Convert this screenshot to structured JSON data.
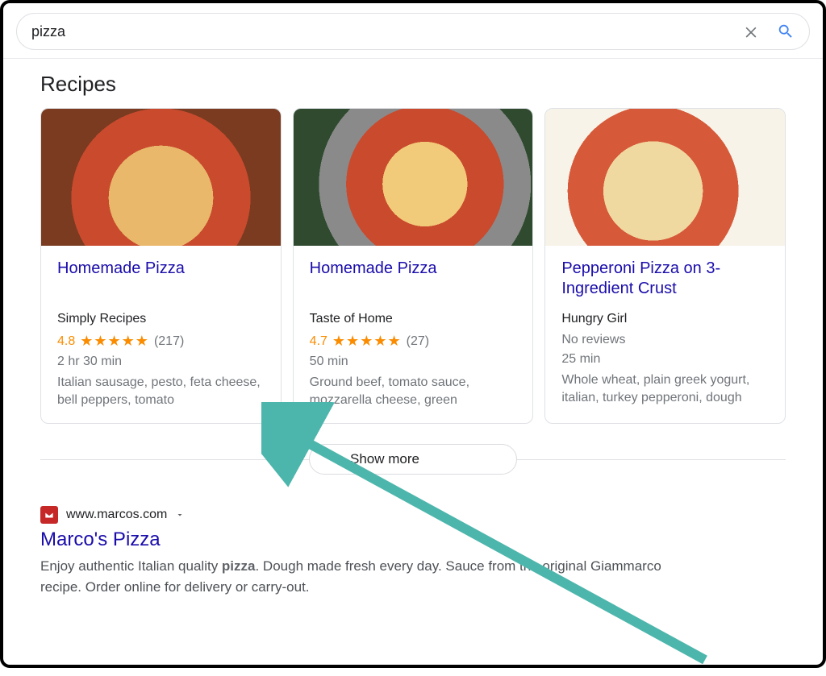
{
  "search": {
    "query": "pizza",
    "clear_icon": "clear-icon",
    "search_icon": "search-icon"
  },
  "section_title": "Recipes",
  "recipes": [
    {
      "title": "Homemade Pizza",
      "source": "Simply Recipes",
      "rating": "4.8",
      "stars": "★★★★★",
      "reviews": "(217)",
      "time": "2 hr 30 min",
      "ingredients": "Italian sausage, pesto, feta cheese, bell peppers, tomato"
    },
    {
      "title": "Homemade Pizza",
      "source": "Taste of Home",
      "rating": "4.7",
      "stars": "★★★★★",
      "reviews": "(27)",
      "time": "50 min",
      "ingredients": "Ground beef, tomato sauce, mozzarella cheese, green"
    },
    {
      "title": "Pepperoni Pizza on 3-Ingredient Crust",
      "source": "Hungry Girl",
      "no_reviews": "No reviews",
      "time": "25 min",
      "ingredients": "Whole wheat, plain greek yogurt, italian, turkey pepperoni, dough"
    }
  ],
  "show_more": "Show more",
  "result": {
    "url": "www.marcos.com",
    "title": "Marco's Pizza",
    "desc_pre": "Enjoy authentic Italian quality ",
    "desc_bold": "pizza",
    "desc_post": ". Dough made fresh every day. Sauce from the original Giammarco recipe. Order online for delivery or carry-out."
  },
  "colors": {
    "link": "#1a0dab",
    "rating": "#fb8c00",
    "arrow": "#4db6ac"
  }
}
